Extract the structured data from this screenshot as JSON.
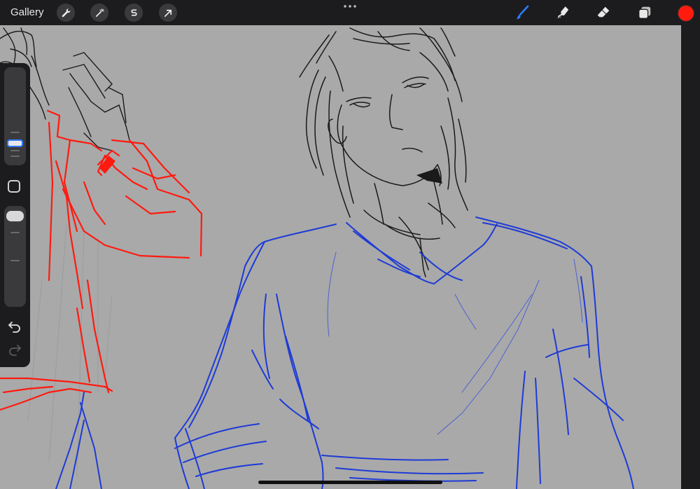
{
  "app": {
    "gallery_label": "Gallery"
  },
  "toolbar": {
    "left_buttons": [
      "actions-wrench",
      "adjustments-magic-wand",
      "selection-s",
      "transform-arrow"
    ],
    "right_tools": [
      "brush",
      "smudge",
      "eraser",
      "layers"
    ],
    "active_tool": "brush",
    "current_color": "#ff1b0e",
    "accent_color": "#2e7bff"
  },
  "sidebar": {
    "brush_size": 0.7,
    "opacity": 1.0
  },
  "canvas": {
    "background": "#a9a9a9",
    "stroke_colors": {
      "sketch": "#1a1a1a",
      "red_layer": "#ff1a0f",
      "blue_layer": "#1e3bd6"
    }
  }
}
